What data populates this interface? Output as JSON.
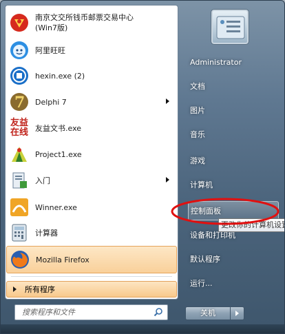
{
  "programs": [
    {
      "label_line1": "南京文交所钱币邮票交易中心",
      "label_line2": "(Win7版)",
      "icon": "nanjing-exchange-icon"
    },
    {
      "label": "阿里旺旺",
      "icon": "aliwangwang-icon"
    },
    {
      "label": "hexin.exe (2)",
      "icon": "hexin-icon"
    },
    {
      "label": "Delphi 7",
      "icon": "delphi-icon",
      "has_submenu": true
    },
    {
      "label": "友益文书.exe",
      "icon": "youyi-wenshu-icon",
      "icon_text_line1": "友益",
      "icon_text_line2": "在线"
    },
    {
      "label": "Project1.exe",
      "icon": "project1-icon"
    },
    {
      "label": "入门",
      "icon": "getting-started-icon",
      "has_submenu": true
    },
    {
      "label": "Winner.exe",
      "icon": "winner-icon"
    },
    {
      "label": "计算器",
      "icon": "calculator-icon"
    },
    {
      "label": "Mozilla Firefox",
      "icon": "firefox-icon",
      "highlighted": true
    }
  ],
  "all_programs": "所有程序",
  "search": {
    "placeholder": "搜索程序和文件"
  },
  "right_items": [
    {
      "label": "Administrator"
    },
    {
      "label": "文档"
    },
    {
      "label": "图片"
    },
    {
      "label": "音乐"
    },
    {
      "label": "游戏"
    },
    {
      "label": "计算机"
    },
    {
      "label": "控制面板",
      "selected": true
    },
    {
      "label": "设备和打印机"
    },
    {
      "label": "默认程序"
    },
    {
      "label": "运行..."
    }
  ],
  "tooltip": "更改你的计算机设置",
  "shutdown": "关机",
  "colors": {
    "highlight_fill": "#f9d09a",
    "highlight_border": "#e5a35a",
    "annotation_red": "#e01010",
    "right_pane_bg": "#4c657d"
  }
}
